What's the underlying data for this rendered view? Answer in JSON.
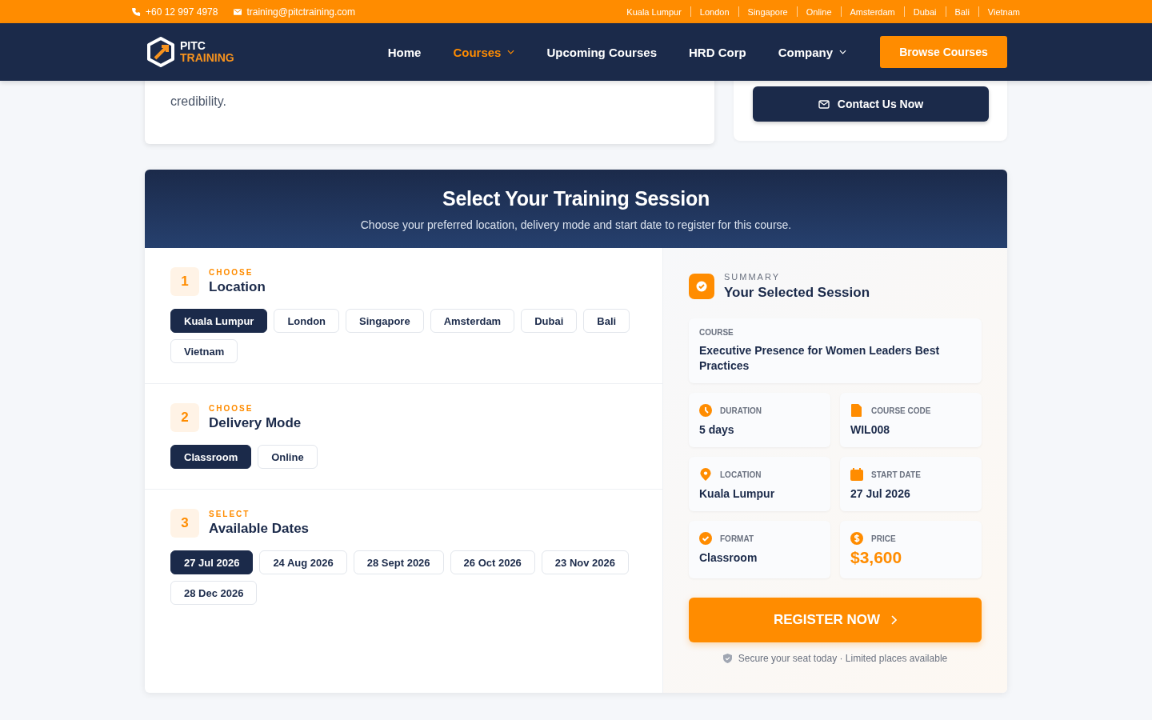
{
  "topbar": {
    "phone": "+60 12 997 4978",
    "email": "training@pitctraining.com",
    "locations": [
      "Kuala Lumpur",
      "London",
      "Singapore",
      "Online",
      "Amsterdam",
      "Dubai",
      "Bali",
      "Vietnam"
    ]
  },
  "nav": {
    "logo_top": "PITC",
    "logo_bottom": "TRAINING",
    "items": [
      {
        "label": "Home",
        "selected": false,
        "dropdown": false
      },
      {
        "label": "Courses",
        "selected": true,
        "dropdown": true
      },
      {
        "label": "Upcoming Courses",
        "selected": false,
        "dropdown": false
      },
      {
        "label": "HRD Corp",
        "selected": false,
        "dropdown": false
      },
      {
        "label": "Company",
        "selected": false,
        "dropdown": true
      }
    ],
    "cta": "Browse Courses"
  },
  "intro": {
    "lines": [
      "credibility."
    ],
    "contact_button": "Contact Us Now"
  },
  "session": {
    "title": "Select Your Training Session",
    "subtitle": "Choose your preferred location, delivery mode and start date to register for this course.",
    "steps": [
      {
        "number": "1",
        "eyebrow": "CHOOSE",
        "title": "Location",
        "options": [
          {
            "label": "Kuala Lumpur",
            "selected": true
          },
          {
            "label": "London",
            "selected": false
          },
          {
            "label": "Singapore",
            "selected": false
          },
          {
            "label": "Amsterdam",
            "selected": false
          },
          {
            "label": "Dubai",
            "selected": false
          },
          {
            "label": "Bali",
            "selected": false
          },
          {
            "label": "Vietnam",
            "selected": false
          }
        ]
      },
      {
        "number": "2",
        "eyebrow": "CHOOSE",
        "title": "Delivery Mode",
        "options": [
          {
            "label": "Classroom",
            "selected": true
          },
          {
            "label": "Online",
            "selected": false
          }
        ]
      },
      {
        "number": "3",
        "eyebrow": "SELECT",
        "title": "Available Dates",
        "options": [
          {
            "label": "27 Jul 2026",
            "selected": true
          },
          {
            "label": "24 Aug 2026",
            "selected": false
          },
          {
            "label": "28 Sept 2026",
            "selected": false
          },
          {
            "label": "26 Oct 2026",
            "selected": false
          },
          {
            "label": "23 Nov 2026",
            "selected": false
          },
          {
            "label": "28 Dec 2026",
            "selected": false
          }
        ]
      }
    ],
    "summary": {
      "eyebrow": "SUMMARY",
      "title": "Your Selected Session",
      "course_label": "COURSE",
      "course_name": "Executive Presence for Women Leaders Best Practices",
      "facts": [
        {
          "kind": "clock",
          "label": "DURATION",
          "value": "5 days"
        },
        {
          "kind": "file",
          "label": "COURSE CODE",
          "value": "WIL008"
        },
        {
          "kind": "pin",
          "label": "LOCATION",
          "value": "Kuala Lumpur"
        },
        {
          "kind": "calendar",
          "label": "START DATE",
          "value": "27 Jul 2026"
        },
        {
          "kind": "check",
          "label": "FORMAT",
          "value": "Classroom"
        },
        {
          "kind": "price",
          "label": "PRICE",
          "value": "$3,600"
        }
      ],
      "register": "REGISTER NOW",
      "note": "Secure your seat today · Limited places available"
    }
  }
}
